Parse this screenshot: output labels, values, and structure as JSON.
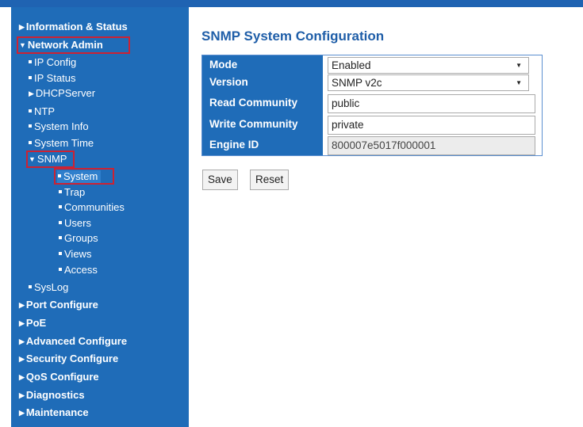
{
  "sidebar": {
    "items": [
      {
        "label": "Information & Status"
      },
      {
        "label": "Network Admin"
      },
      {
        "label": "IP Config"
      },
      {
        "label": "IP Status"
      },
      {
        "label": "DHCPServer"
      },
      {
        "label": "NTP"
      },
      {
        "label": "System Info"
      },
      {
        "label": "System Time"
      },
      {
        "label": "SNMP"
      },
      {
        "label": "System"
      },
      {
        "label": "Trap"
      },
      {
        "label": "Communities"
      },
      {
        "label": "Users"
      },
      {
        "label": "Groups"
      },
      {
        "label": "Views"
      },
      {
        "label": "Access"
      },
      {
        "label": "SysLog"
      },
      {
        "label": "Port Configure"
      },
      {
        "label": "PoE"
      },
      {
        "label": "Advanced Configure"
      },
      {
        "label": "Security Configure"
      },
      {
        "label": "QoS Configure"
      },
      {
        "label": "Diagnostics"
      },
      {
        "label": "Maintenance"
      }
    ]
  },
  "main": {
    "title": "SNMP System Configuration",
    "form": {
      "mode": {
        "label": "Mode",
        "value": "Enabled"
      },
      "version": {
        "label": "Version",
        "value": "SNMP v2c"
      },
      "read_community": {
        "label": "Read Community",
        "value": "public"
      },
      "write_community": {
        "label": "Write Community",
        "value": "private"
      },
      "engine_id": {
        "label": "Engine ID",
        "value": "800007e5017f000001"
      }
    },
    "buttons": {
      "save": "Save",
      "reset": "Reset"
    }
  },
  "colors": {
    "sidebar_bg": "#1f6cb8",
    "title": "#1f5ea8",
    "highlight": "#cc2233"
  }
}
